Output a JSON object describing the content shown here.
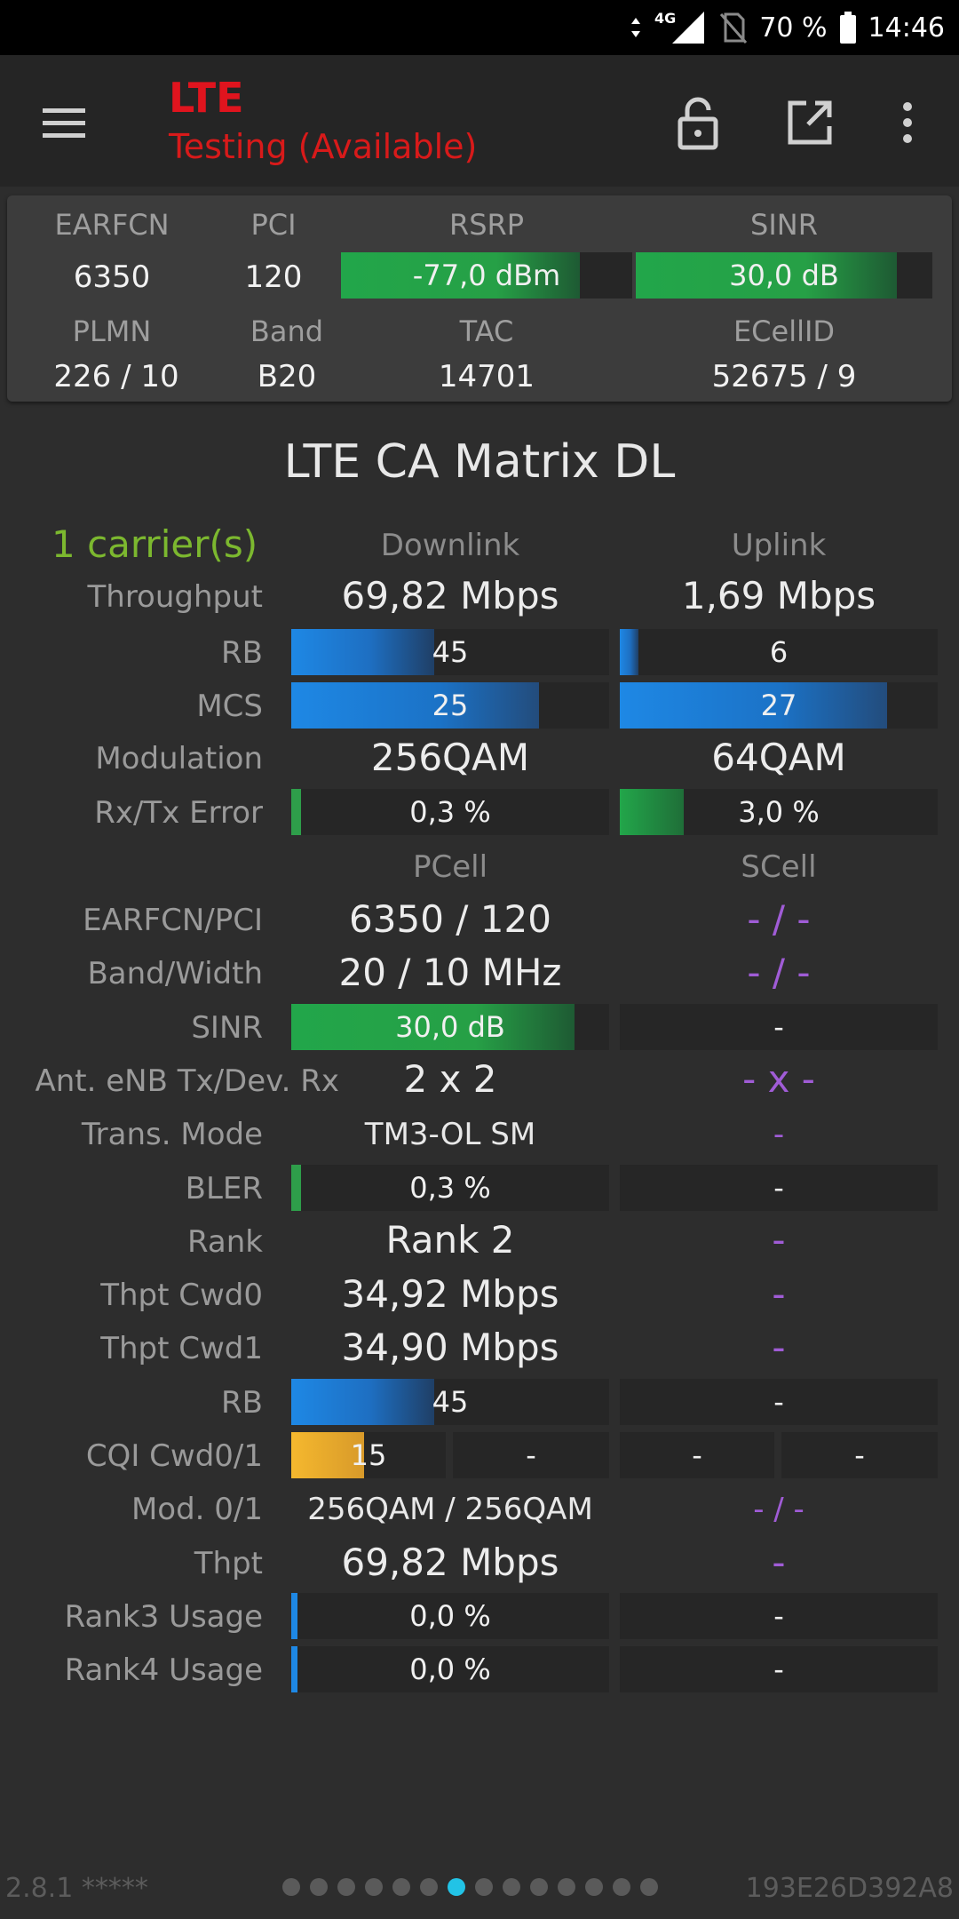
{
  "status_bar": {
    "network": "4G",
    "battery": "70 %",
    "time": "14:46"
  },
  "app_bar": {
    "title": "LTE",
    "subtitle": "Testing (Available)"
  },
  "info_card": {
    "labels": {
      "earfcn": "EARFCN",
      "pci": "PCI",
      "rsrp": "RSRP",
      "sinr": "SINR",
      "plmn": "PLMN",
      "band": "Band",
      "tac": "TAC",
      "ecellid": "ECellID"
    },
    "earfcn": "6350",
    "pci": "120",
    "rsrp": "-77,0 dBm",
    "sinr": "30,0 dB",
    "plmn": "226 / 10",
    "band": "B20",
    "tac": "14701",
    "ecellid": "52675 / 9",
    "rsrp_level": 0.82,
    "sinr_level": 0.88
  },
  "matrix": {
    "title": "LTE CA Matrix DL",
    "carriers": "1 carrier(s)",
    "headers": {
      "downlink": "Downlink",
      "uplink": "Uplink",
      "pcell": "PCell",
      "scell": "SCell"
    },
    "labels": {
      "throughput": "Throughput",
      "rb": "RB",
      "mcs": "MCS",
      "modulation": "Modulation",
      "rxtx_error": "Rx/Tx Error",
      "earfcn_pci": "EARFCN/PCI",
      "band_width": "Band/Width",
      "sinr": "SINR",
      "antennas": "Ant. eNB Tx/Dev. Rx",
      "trans_mode": "Trans. Mode",
      "bler": "BLER",
      "rank": "Rank",
      "thpt_cwd0": "Thpt Cwd0",
      "thpt_cwd1": "Thpt Cwd1",
      "rb2": "RB",
      "cqi": "CQI Cwd0/1",
      "mod01": "Mod. 0/1",
      "thpt": "Thpt",
      "rank3": "Rank3 Usage",
      "rank4": "Rank4 Usage"
    },
    "downlink": {
      "throughput": "69,82 Mbps",
      "rb": "45",
      "rb_level": 0.45,
      "mcs": "25",
      "mcs_level": 0.78,
      "modulation": "256QAM",
      "error": "0,3 %",
      "error_level": 0.03
    },
    "uplink": {
      "throughput": "1,69 Mbps",
      "rb": "6",
      "rb_level": 0.06,
      "mcs": "27",
      "mcs_level": 0.84,
      "modulation": "64QAM",
      "error": "3,0 %",
      "error_level": 0.2
    },
    "pcell": {
      "earfcn_pci": "6350 / 120",
      "band_width": "20 / 10 MHz",
      "sinr": "30,0 dB",
      "sinr_level": 0.89,
      "antennas": "2 x 2",
      "trans_mode": "TM3-OL SM",
      "bler": "0,3 %",
      "bler_level": 0.03,
      "rank": "Rank 2",
      "thpt_cwd0": "34,92 Mbps",
      "thpt_cwd1": "34,90 Mbps",
      "rb": "45",
      "rb_level": 0.45,
      "cqi0": "15",
      "cqi0_level": 0.47,
      "cqi1": "-",
      "mod01": "256QAM / 256QAM",
      "thpt": "69,82 Mbps",
      "rank3": "0,0 %",
      "rank3_level": 0.02,
      "rank4": "0,0 %",
      "rank4_level": 0.02
    },
    "scell": {
      "earfcn_pci": "- / -",
      "band_width": "- / -",
      "sinr": "-",
      "antennas": "- x -",
      "trans_mode": "-",
      "bler": "-",
      "rank": "-",
      "thpt_cwd0": "-",
      "thpt_cwd1": "-",
      "rb": "-",
      "cqi0": "-",
      "cqi1": "-",
      "mod01": "- / -",
      "thpt": "-",
      "rank3": "-",
      "rank4": "-"
    }
  },
  "footer": {
    "version": "2.8.1 *****",
    "device_id": "193E26D392A8",
    "page_count": 14,
    "active_page": 6
  },
  "colors": {
    "accent_red": "#e0141e",
    "carrier_green": "#7cb82f",
    "purple": "#a05cd6",
    "dot_active": "#22c3e6"
  }
}
